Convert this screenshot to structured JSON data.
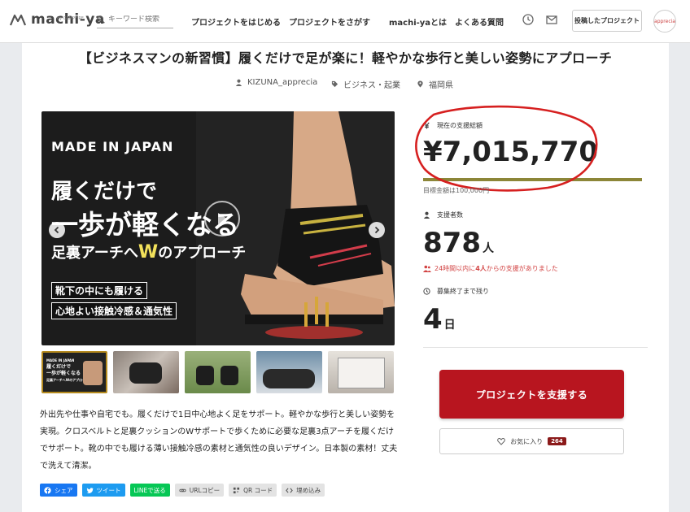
{
  "header": {
    "logo_text": "machi-ya",
    "logo_sub": "by CAMPFIRE",
    "search_placeholder": "キーワード検索",
    "nav": [
      "プロジェクトをはじめる",
      "プロジェクトをさがす",
      "machi-yaとは",
      "よくある質問"
    ],
    "posted_projects": "投稿したプロジェクト",
    "avatar_text": "apprecia",
    "icons": [
      "history-icon",
      "mail-icon"
    ]
  },
  "project": {
    "title": "【ビジネスマンの新習慣】履くだけで足が楽に！軽やかな歩行と美しい姿勢にアプローチ",
    "owner": "KIZUNA_apprecia",
    "category": "ビジネス・起業",
    "location": "福岡県"
  },
  "hero": {
    "made_in": "MADE IN JAPAN",
    "line1": "履くだけで",
    "line2": "一歩が軽くなる",
    "line3_pre": "足裏アーチへ",
    "line3_w": "W",
    "line3_post": "のアプローチ",
    "tag1": "靴下の中にも履ける",
    "tag2": "心地よい接触冷感＆通気性"
  },
  "thumbnail_1": {
    "brand": "MADE IN JAPAN",
    "line1": "履くだけで",
    "line2": "一歩が軽くなる",
    "line3": "足裏アーチへWのアプローチ"
  },
  "description": "外出先や仕事や自宅でも。履くだけで1日中心地よく足をサポート。軽やかな歩行と美しい姿勢を実現。クロスベルトと足裏クッションのWサポートで歩くために必要な足裏3点アーチを履くだけでサポート。靴の中でも履ける薄い接触冷感の素材と通気性の良いデザイン。日本製の素材！丈夫で洗えて清潔。",
  "share": {
    "facebook": "シェア",
    "twitter": "ツイート",
    "line": "LINEで送る",
    "url_copy": "URLコピー",
    "qr": "QR コード",
    "embed": "埋め込み"
  },
  "funding": {
    "current_label": "現在の支援総額",
    "amount": "¥7,015,770",
    "goal": "目標金額は100,000円",
    "progress_fraction": 1.0,
    "supporters_label": "支援者数",
    "supporters": "878",
    "supporters_unit": "人",
    "recent_pre": "24時間以内に",
    "recent_count": "4人",
    "recent_post": "からの支援がありました",
    "remaining_label": "募集終了まで残り",
    "remaining": "4",
    "remaining_unit": "日",
    "support_button": "プロジェクトを支援する",
    "favorite_label": "お気に入り",
    "favorite_count": "264"
  },
  "colors": {
    "support_button": "#b8151f",
    "progress": "#8c8638",
    "annotation_circle": "#d62020",
    "recent_text": "#d24343"
  }
}
